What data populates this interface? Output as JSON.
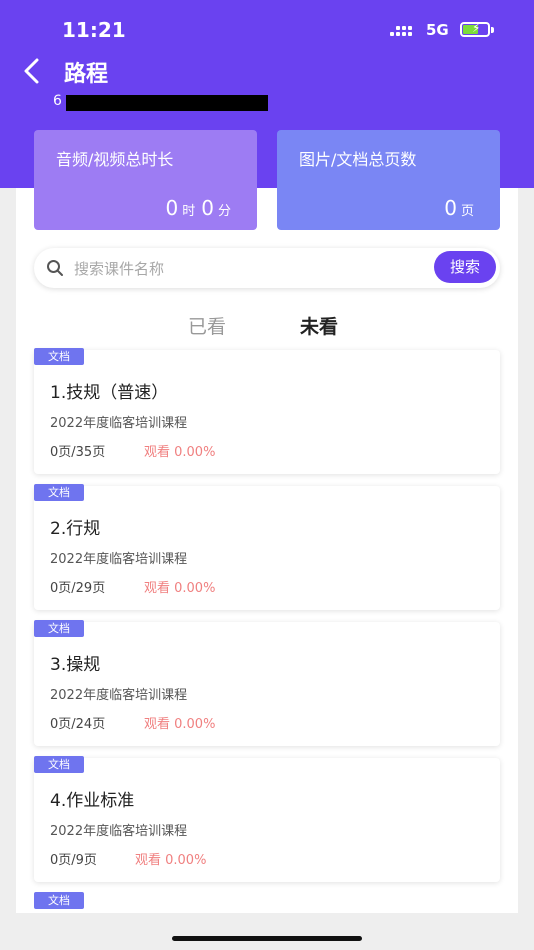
{
  "status_bar": {
    "time": "11:21",
    "network": "5G"
  },
  "header": {
    "title": "路程",
    "user_id_prefix": "6"
  },
  "stats": {
    "media": {
      "title": "音频/视频总时长",
      "hours": "0",
      "hours_unit": "时",
      "minutes": "0",
      "minutes_unit": "分"
    },
    "docs": {
      "title": "图片/文档总页数",
      "pages": "0",
      "pages_unit": "页"
    }
  },
  "search": {
    "placeholder": "搜索课件名称",
    "button_label": "搜索"
  },
  "tabs": {
    "watched": "已看",
    "unwatched": "未看"
  },
  "courses": [
    {
      "badge": "文档",
      "title": "1.技规（普速）",
      "subtitle": "2022年度临客培训课程",
      "pages": "0页/35页",
      "progress": "观看 0.00%"
    },
    {
      "badge": "文档",
      "title": "2.行规",
      "subtitle": "2022年度临客培训课程",
      "pages": "0页/29页",
      "progress": "观看 0.00%"
    },
    {
      "badge": "文档",
      "title": "3.操规",
      "subtitle": "2022年度临客培训课程",
      "pages": "0页/24页",
      "progress": "观看 0.00%"
    },
    {
      "badge": "文档",
      "title": "4.作业标准",
      "subtitle": "2022年度临客培训课程",
      "pages": "0页/9页",
      "progress": "观看 0.00%"
    },
    {
      "badge": "文档"
    }
  ],
  "colors": {
    "primary": "#6a42f0",
    "media_card": "#9d7cf3",
    "doc_card": "#7a86f4",
    "badge": "#6f74ef",
    "progress_text": "#f08080"
  }
}
